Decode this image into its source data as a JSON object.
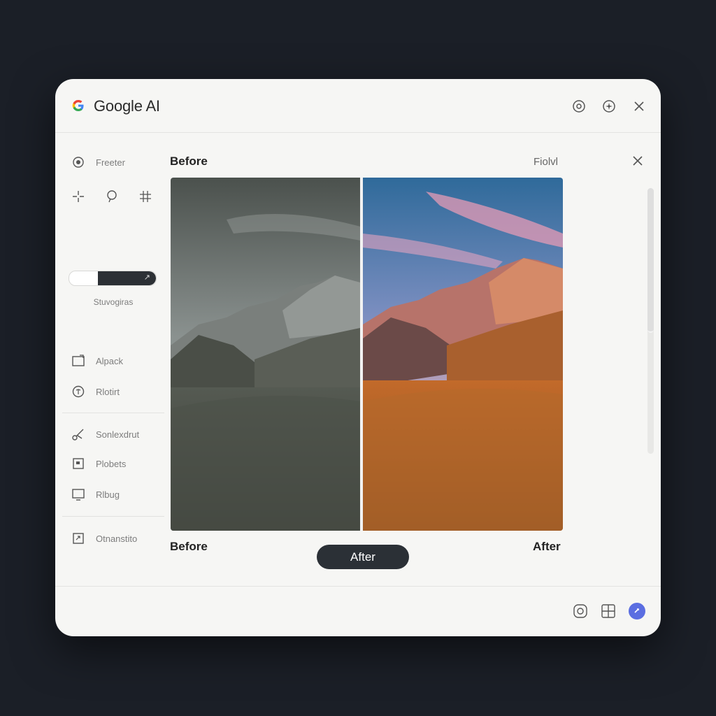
{
  "window": {
    "title": "Google AI"
  },
  "sidebar": {
    "top_item": "Freeter",
    "slider_label": "Stuvogiras",
    "items_a": [
      "Alpack",
      "Rlotirt"
    ],
    "items_b": [
      "Sonlexdrut",
      "Plobets",
      "Rlbug"
    ],
    "items_c": [
      "Otnanstito"
    ]
  },
  "main": {
    "before_label_top": "Before",
    "right_label_top": "Fiolvl",
    "before_label_bottom": "Before",
    "after_label_bottom": "After",
    "toggle_label": "After"
  },
  "slider": {
    "value_fraction": 0.67
  },
  "icons": {
    "window": [
      "settings-icon",
      "sparkle-icon",
      "close-icon"
    ],
    "footer": [
      "camera-icon",
      "grid-icon",
      "assistant-icon"
    ]
  },
  "colors": {
    "accent": "#5b6ee1",
    "dark": "#2b3036"
  }
}
